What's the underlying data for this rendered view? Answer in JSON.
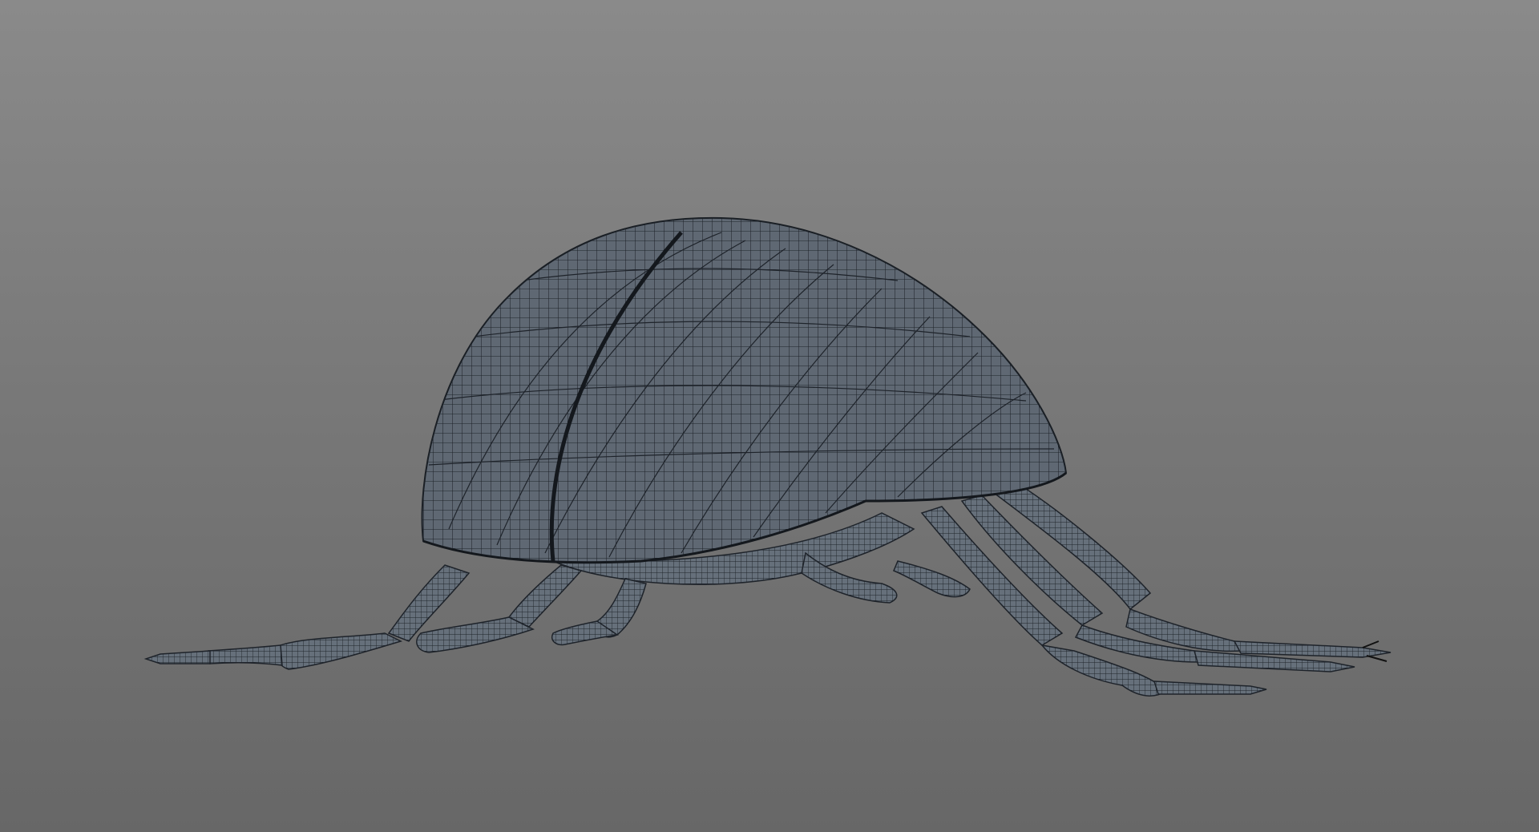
{
  "viewport": {
    "background_top": "#8a8a8a",
    "background_bottom": "#676767",
    "render_mode": "wireframe-on-shaded"
  },
  "model": {
    "subject": "beetle",
    "surface_color": "#5f6873",
    "wire_color": "#1e232a",
    "leg_count": 6
  }
}
